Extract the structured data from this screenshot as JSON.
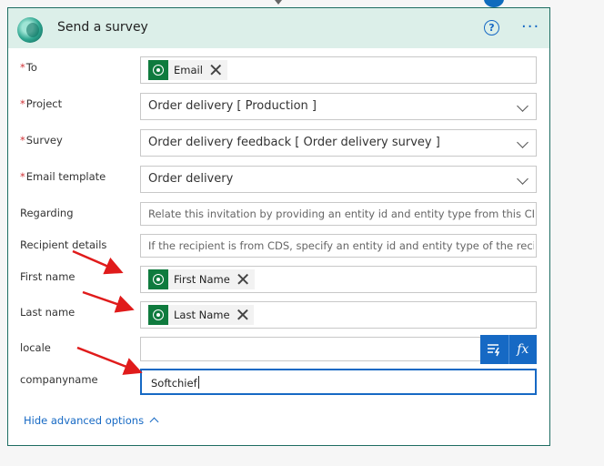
{
  "card": {
    "title": "Send a survey",
    "accent_color": "#1e6d62",
    "header_bg": "#dcefe9"
  },
  "fields": {
    "to": {
      "label": "To",
      "required": true,
      "token": "Email"
    },
    "project": {
      "label": "Project",
      "required": true,
      "value": "Order delivery [ Production ]"
    },
    "survey": {
      "label": "Survey",
      "required": true,
      "value": "Order delivery feedback [ Order delivery survey ]"
    },
    "email_template": {
      "label": "Email template",
      "required": true,
      "value": "Order delivery"
    },
    "regarding": {
      "label": "Regarding",
      "placeholder": "Relate this invitation by providing an entity id and entity type from this CDS in t"
    },
    "recipient_details": {
      "label": "Recipient details",
      "placeholder": "If the recipient is from CDS, specify an entity id and entity type of the recipient"
    },
    "first_name": {
      "label": "First name",
      "token": "First Name"
    },
    "last_name": {
      "label": "Last name",
      "token": "Last Name"
    },
    "locale": {
      "label": "locale",
      "value": ""
    },
    "companyname": {
      "label": "companyname",
      "value": "Softchief"
    }
  },
  "dynamic_buttons": {
    "fx": "fx"
  },
  "footer": {
    "hide_advanced": "Hide advanced options"
  },
  "icons": [
    "dataverse-logo-icon",
    "help-icon",
    "more-icon",
    "chevron-down-icon",
    "close-icon",
    "dynamic-content-icon",
    "expression-icon",
    "chevron-up-icon",
    "annotation-arrow-icon"
  ],
  "colors": {
    "link": "#1669c4",
    "required": "#d13438",
    "token_icon": "#0f7b3e"
  }
}
